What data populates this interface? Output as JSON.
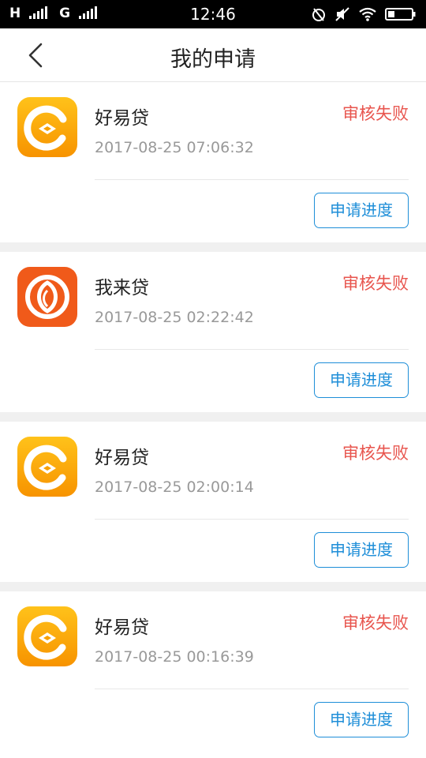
{
  "status_bar": {
    "signal_label": "H",
    "network_label": "G",
    "time": "12:46",
    "icons": [
      "alarm-icon",
      "mute-icon",
      "wifi-icon",
      "battery-icon"
    ]
  },
  "header": {
    "title": "我的申请",
    "back_icon": "chevron-left-icon"
  },
  "colors": {
    "status_failed": "#e8554e",
    "accent_blue": "#1e8ed8",
    "icon_orange_yellow": "#f7a000",
    "icon_red_orange": "#f05a1a"
  },
  "applications": [
    {
      "name": "好易贷",
      "time": "2017-08-25 07:06:32",
      "status": "审核失败",
      "button": "申请进度",
      "icon": "haoyidai-logo-icon"
    },
    {
      "name": "我来贷",
      "time": "2017-08-25 02:22:42",
      "status": "审核失败",
      "button": "申请进度",
      "icon": "wolaidai-logo-icon"
    },
    {
      "name": "好易贷",
      "time": "2017-08-25 02:00:14",
      "status": "审核失败",
      "button": "申请进度",
      "icon": "haoyidai-logo-icon"
    },
    {
      "name": "好易贷",
      "time": "2017-08-25 00:16:39",
      "status": "审核失败",
      "button": "申请进度",
      "icon": "haoyidai-logo-icon"
    }
  ]
}
